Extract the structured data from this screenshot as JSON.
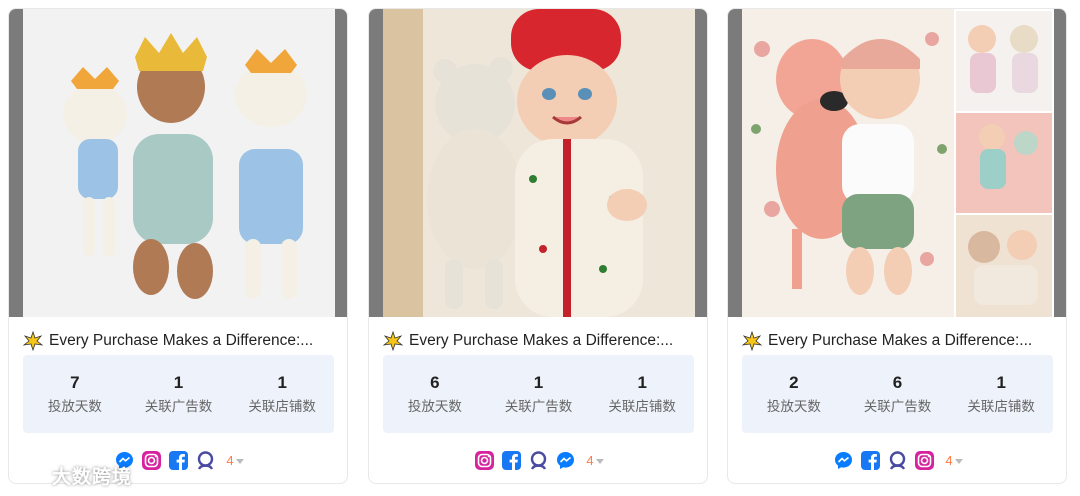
{
  "cards": [
    {
      "title": "Every Purchase Makes a Difference:...",
      "stats": [
        {
          "value": "7",
          "label": "投放天数"
        },
        {
          "value": "1",
          "label": "关联广告数"
        },
        {
          "value": "1",
          "label": "关联店铺数"
        }
      ],
      "platforms": [
        "messenger-icon",
        "instagram-icon",
        "facebook-icon",
        "audience-network-icon"
      ],
      "more_count": "4"
    },
    {
      "title": "Every Purchase Makes a Difference:...",
      "stats": [
        {
          "value": "6",
          "label": "投放天数"
        },
        {
          "value": "1",
          "label": "关联广告数"
        },
        {
          "value": "1",
          "label": "关联店铺数"
        }
      ],
      "platforms": [
        "instagram-icon",
        "facebook-icon",
        "audience-network-icon",
        "messenger-icon"
      ],
      "more_count": "4"
    },
    {
      "title": "Every Purchase Makes a Difference:...",
      "stats": [
        {
          "value": "2",
          "label": "投放天数"
        },
        {
          "value": "6",
          "label": "关联广告数"
        },
        {
          "value": "1",
          "label": "关联店铺数"
        }
      ],
      "platforms": [
        "messenger-icon",
        "facebook-icon",
        "audience-network-icon",
        "instagram-icon"
      ],
      "more_count": "4"
    }
  ],
  "watermark": "大数跨境",
  "colors": {
    "stats_bg": "#eef3fb",
    "more_count": "#ff7a45",
    "facebook": "#1877f2",
    "messenger": "#0a7cff",
    "audience_network": "#4a4aa0"
  }
}
